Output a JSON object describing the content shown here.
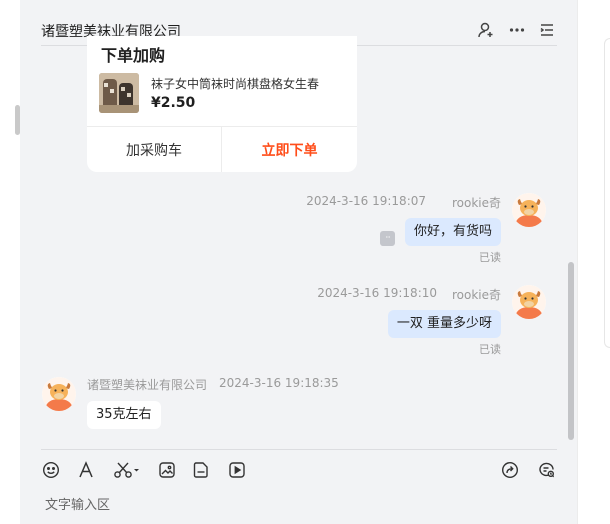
{
  "header": {
    "title": "诸暨塑美袜业有限公司",
    "icons": [
      "add-contact-icon",
      "more-icon",
      "list-icon"
    ]
  },
  "product_card": {
    "title": "下单加购",
    "name": "袜子女中筒袜时尚棋盘格女生春",
    "price": "¥2.50",
    "add_cart_label": "加采购车",
    "order_label": "立即下单"
  },
  "messages": [
    {
      "sender": "rookie奇",
      "time": "2024-3-16 19:18:07",
      "text": "你好，有货吗",
      "status": "已读"
    },
    {
      "sender": "rookie奇",
      "time": "2024-3-16 19:18:10",
      "text": "一双 重量多少呀",
      "status": "已读"
    },
    {
      "sender": "诸暨塑美袜业有限公司",
      "time": "2024-3-16 19:18:35",
      "text": "35克左右"
    }
  ],
  "toolbar": {
    "icons": [
      "emoji-icon",
      "font-icon",
      "scissors-icon",
      "image-icon",
      "file-icon",
      "video-icon",
      "share-icon",
      "chat-history-icon"
    ]
  },
  "compose": {
    "placeholder": "文字输入区"
  },
  "colors": {
    "panel_bg": "#f2f3f5",
    "my_bubble": "#dbe9fe",
    "their_bubble": "#ffffff",
    "accent_orange": "#ff4d1a"
  }
}
